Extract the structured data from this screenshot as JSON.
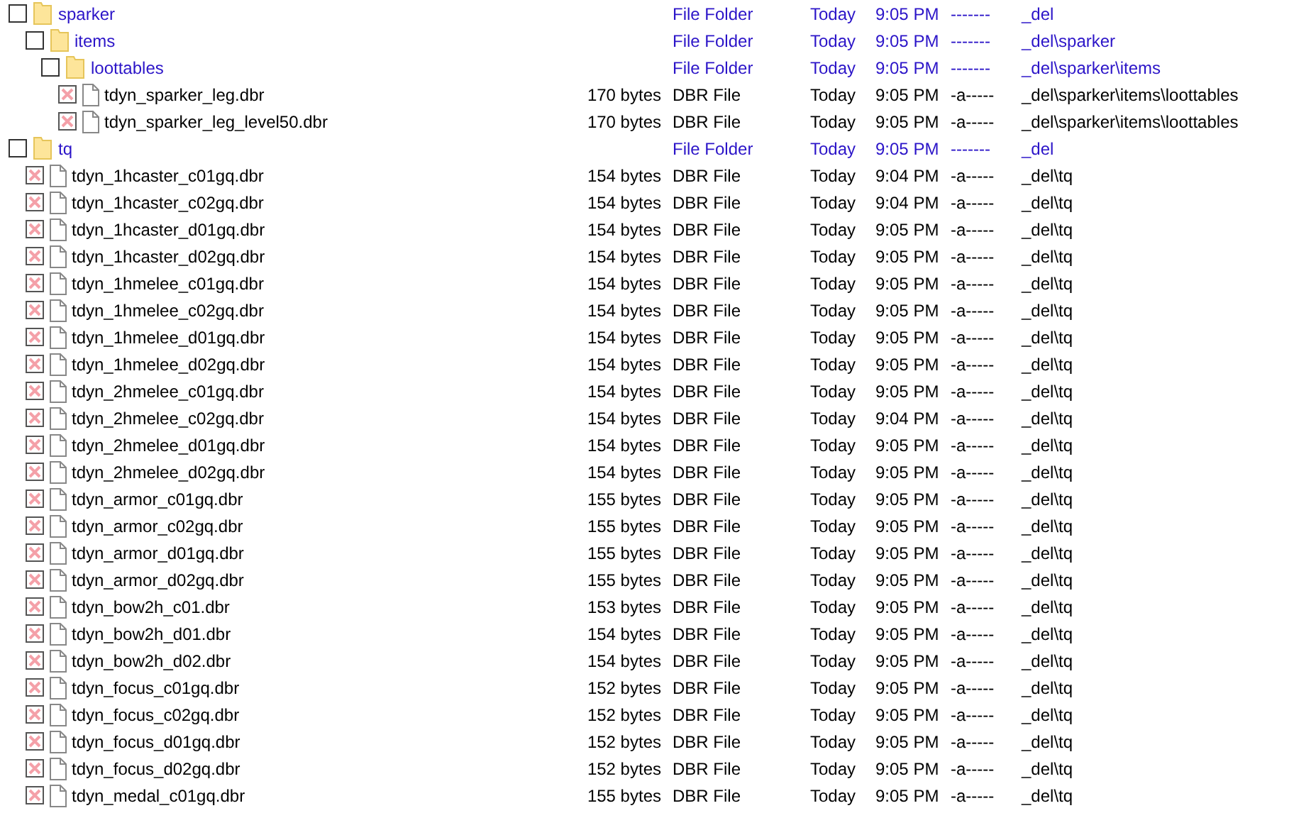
{
  "items": [
    {
      "kind": "folder",
      "name": "sparker",
      "type": "File Folder",
      "date": "Today",
      "time": "9:05 PM",
      "attributes": "-------",
      "path": "_del",
      "checked": false,
      "children": [
        {
          "kind": "folder",
          "name": "items",
          "type": "File Folder",
          "date": "Today",
          "time": "9:05 PM",
          "attributes": "-------",
          "path": "_del\\sparker",
          "checked": false,
          "children": [
            {
              "kind": "folder",
              "name": "loottables",
              "type": "File Folder",
              "date": "Today",
              "time": "9:05 PM",
              "attributes": "-------",
              "path": "_del\\sparker\\items",
              "checked": false,
              "children": [
                {
                  "kind": "file",
                  "name": "tdyn_sparker_leg.dbr",
                  "size": "170 bytes",
                  "type": "DBR File",
                  "date": "Today",
                  "time": "9:05 PM",
                  "attributes": "-a-----",
                  "path": "_del\\sparker\\items\\loottables",
                  "checked": true
                },
                {
                  "kind": "file",
                  "name": "tdyn_sparker_leg_level50.dbr",
                  "size": "170 bytes",
                  "type": "DBR File",
                  "date": "Today",
                  "time": "9:05 PM",
                  "attributes": "-a-----",
                  "path": "_del\\sparker\\items\\loottables",
                  "checked": true
                }
              ]
            }
          ]
        }
      ]
    },
    {
      "kind": "folder",
      "name": "tq",
      "type": "File Folder",
      "date": "Today",
      "time": "9:05 PM",
      "attributes": "-------",
      "path": "_del",
      "checked": false,
      "children": [
        {
          "kind": "file",
          "name": "tdyn_1hcaster_c01gq.dbr",
          "size": "154 bytes",
          "type": "DBR File",
          "date": "Today",
          "time": "9:04 PM",
          "attributes": "-a-----",
          "path": "_del\\tq",
          "checked": true
        },
        {
          "kind": "file",
          "name": "tdyn_1hcaster_c02gq.dbr",
          "size": "154 bytes",
          "type": "DBR File",
          "date": "Today",
          "time": "9:04 PM",
          "attributes": "-a-----",
          "path": "_del\\tq",
          "checked": true
        },
        {
          "kind": "file",
          "name": "tdyn_1hcaster_d01gq.dbr",
          "size": "154 bytes",
          "type": "DBR File",
          "date": "Today",
          "time": "9:05 PM",
          "attributes": "-a-----",
          "path": "_del\\tq",
          "checked": true
        },
        {
          "kind": "file",
          "name": "tdyn_1hcaster_d02gq.dbr",
          "size": "154 bytes",
          "type": "DBR File",
          "date": "Today",
          "time": "9:05 PM",
          "attributes": "-a-----",
          "path": "_del\\tq",
          "checked": true
        },
        {
          "kind": "file",
          "name": "tdyn_1hmelee_c01gq.dbr",
          "size": "154 bytes",
          "type": "DBR File",
          "date": "Today",
          "time": "9:05 PM",
          "attributes": "-a-----",
          "path": "_del\\tq",
          "checked": true
        },
        {
          "kind": "file",
          "name": "tdyn_1hmelee_c02gq.dbr",
          "size": "154 bytes",
          "type": "DBR File",
          "date": "Today",
          "time": "9:05 PM",
          "attributes": "-a-----",
          "path": "_del\\tq",
          "checked": true
        },
        {
          "kind": "file",
          "name": "tdyn_1hmelee_d01gq.dbr",
          "size": "154 bytes",
          "type": "DBR File",
          "date": "Today",
          "time": "9:05 PM",
          "attributes": "-a-----",
          "path": "_del\\tq",
          "checked": true
        },
        {
          "kind": "file",
          "name": "tdyn_1hmelee_d02gq.dbr",
          "size": "154 bytes",
          "type": "DBR File",
          "date": "Today",
          "time": "9:05 PM",
          "attributes": "-a-----",
          "path": "_del\\tq",
          "checked": true
        },
        {
          "kind": "file",
          "name": "tdyn_2hmelee_c01gq.dbr",
          "size": "154 bytes",
          "type": "DBR File",
          "date": "Today",
          "time": "9:05 PM",
          "attributes": "-a-----",
          "path": "_del\\tq",
          "checked": true
        },
        {
          "kind": "file",
          "name": "tdyn_2hmelee_c02gq.dbr",
          "size": "154 bytes",
          "type": "DBR File",
          "date": "Today",
          "time": "9:04 PM",
          "attributes": "-a-----",
          "path": "_del\\tq",
          "checked": true
        },
        {
          "kind": "file",
          "name": "tdyn_2hmelee_d01gq.dbr",
          "size": "154 bytes",
          "type": "DBR File",
          "date": "Today",
          "time": "9:05 PM",
          "attributes": "-a-----",
          "path": "_del\\tq",
          "checked": true
        },
        {
          "kind": "file",
          "name": "tdyn_2hmelee_d02gq.dbr",
          "size": "154 bytes",
          "type": "DBR File",
          "date": "Today",
          "time": "9:05 PM",
          "attributes": "-a-----",
          "path": "_del\\tq",
          "checked": true
        },
        {
          "kind": "file",
          "name": "tdyn_armor_c01gq.dbr",
          "size": "155 bytes",
          "type": "DBR File",
          "date": "Today",
          "time": "9:05 PM",
          "attributes": "-a-----",
          "path": "_del\\tq",
          "checked": true
        },
        {
          "kind": "file",
          "name": "tdyn_armor_c02gq.dbr",
          "size": "155 bytes",
          "type": "DBR File",
          "date": "Today",
          "time": "9:05 PM",
          "attributes": "-a-----",
          "path": "_del\\tq",
          "checked": true
        },
        {
          "kind": "file",
          "name": "tdyn_armor_d01gq.dbr",
          "size": "155 bytes",
          "type": "DBR File",
          "date": "Today",
          "time": "9:05 PM",
          "attributes": "-a-----",
          "path": "_del\\tq",
          "checked": true
        },
        {
          "kind": "file",
          "name": "tdyn_armor_d02gq.dbr",
          "size": "155 bytes",
          "type": "DBR File",
          "date": "Today",
          "time": "9:05 PM",
          "attributes": "-a-----",
          "path": "_del\\tq",
          "checked": true
        },
        {
          "kind": "file",
          "name": "tdyn_bow2h_c01.dbr",
          "size": "153 bytes",
          "type": "DBR File",
          "date": "Today",
          "time": "9:05 PM",
          "attributes": "-a-----",
          "path": "_del\\tq",
          "checked": true
        },
        {
          "kind": "file",
          "name": "tdyn_bow2h_d01.dbr",
          "size": "154 bytes",
          "type": "DBR File",
          "date": "Today",
          "time": "9:05 PM",
          "attributes": "-a-----",
          "path": "_del\\tq",
          "checked": true
        },
        {
          "kind": "file",
          "name": "tdyn_bow2h_d02.dbr",
          "size": "154 bytes",
          "type": "DBR File",
          "date": "Today",
          "time": "9:05 PM",
          "attributes": "-a-----",
          "path": "_del\\tq",
          "checked": true
        },
        {
          "kind": "file",
          "name": "tdyn_focus_c01gq.dbr",
          "size": "152 bytes",
          "type": "DBR File",
          "date": "Today",
          "time": "9:05 PM",
          "attributes": "-a-----",
          "path": "_del\\tq",
          "checked": true
        },
        {
          "kind": "file",
          "name": "tdyn_focus_c02gq.dbr",
          "size": "152 bytes",
          "type": "DBR File",
          "date": "Today",
          "time": "9:05 PM",
          "attributes": "-a-----",
          "path": "_del\\tq",
          "checked": true
        },
        {
          "kind": "file",
          "name": "tdyn_focus_d01gq.dbr",
          "size": "152 bytes",
          "type": "DBR File",
          "date": "Today",
          "time": "9:05 PM",
          "attributes": "-a-----",
          "path": "_del\\tq",
          "checked": true
        },
        {
          "kind": "file",
          "name": "tdyn_focus_d02gq.dbr",
          "size": "152 bytes",
          "type": "DBR File",
          "date": "Today",
          "time": "9:05 PM",
          "attributes": "-a-----",
          "path": "_del\\tq",
          "checked": true
        },
        {
          "kind": "file",
          "name": "tdyn_medal_c01gq.dbr",
          "size": "155 bytes",
          "type": "DBR File",
          "date": "Today",
          "time": "9:05 PM",
          "attributes": "-a-----",
          "path": "_del\\tq",
          "checked": true
        }
      ]
    }
  ]
}
